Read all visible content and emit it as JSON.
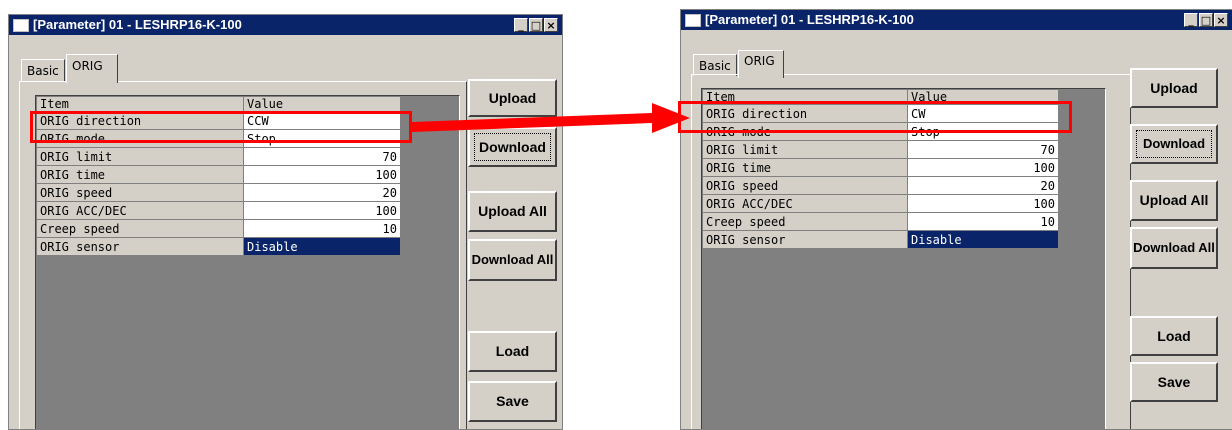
{
  "left_window": {
    "title": "[Parameter] 01 - LESHRP16-K-100",
    "title_buttons": [
      "_",
      "□",
      "×"
    ],
    "tabs": [
      {
        "label": "Basic"
      },
      {
        "label": "ORIG"
      }
    ],
    "grid": {
      "header": {
        "item": "Item",
        "value": "Value"
      },
      "rows": [
        {
          "item": "ORIG direction",
          "value": "CCW"
        },
        {
          "item": "ORIG mode",
          "value": "Stop"
        },
        {
          "item": "ORIG limit",
          "value": "70"
        },
        {
          "item": "ORIG time",
          "value": "100"
        },
        {
          "item": "ORIG speed",
          "value": "20"
        },
        {
          "item": "ORIG ACC/DEC",
          "value": "100"
        },
        {
          "item": "Creep speed",
          "value": "10"
        },
        {
          "item": "ORIG sensor",
          "value": "Disable"
        }
      ]
    },
    "buttons": {
      "upload": "Upload",
      "download": "Download",
      "upload_all": "Upload All",
      "download_all": "Download All",
      "load": "Load",
      "save": "Save"
    }
  },
  "right_window": {
    "title": "[Parameter] 01 - LESHRP16-K-100",
    "title_buttons": [
      "_",
      "□",
      "×"
    ],
    "tabs": [
      {
        "label": "Basic"
      },
      {
        "label": "ORIG"
      }
    ],
    "grid": {
      "header": {
        "item": "Item",
        "value": "Value"
      },
      "rows": [
        {
          "item": "ORIG direction",
          "value": "CW"
        },
        {
          "item": "ORIG mode",
          "value": "Stop"
        },
        {
          "item": "ORIG limit",
          "value": "70"
        },
        {
          "item": "ORIG time",
          "value": "100"
        },
        {
          "item": "ORIG speed",
          "value": "20"
        },
        {
          "item": "ORIG ACC/DEC",
          "value": "100"
        },
        {
          "item": "Creep speed",
          "value": "10"
        },
        {
          "item": "ORIG sensor",
          "value": "Disable"
        }
      ]
    },
    "buttons": {
      "upload": "Upload",
      "download": "Download",
      "upload_all": "Upload All",
      "download_all": "Download All",
      "load": "Load",
      "save": "Save"
    }
  },
  "colors": {
    "highlight": "#ff0000",
    "arrow": "#ff0000",
    "titlebar": "#0a246a",
    "selected_cell": "#0a246a"
  }
}
